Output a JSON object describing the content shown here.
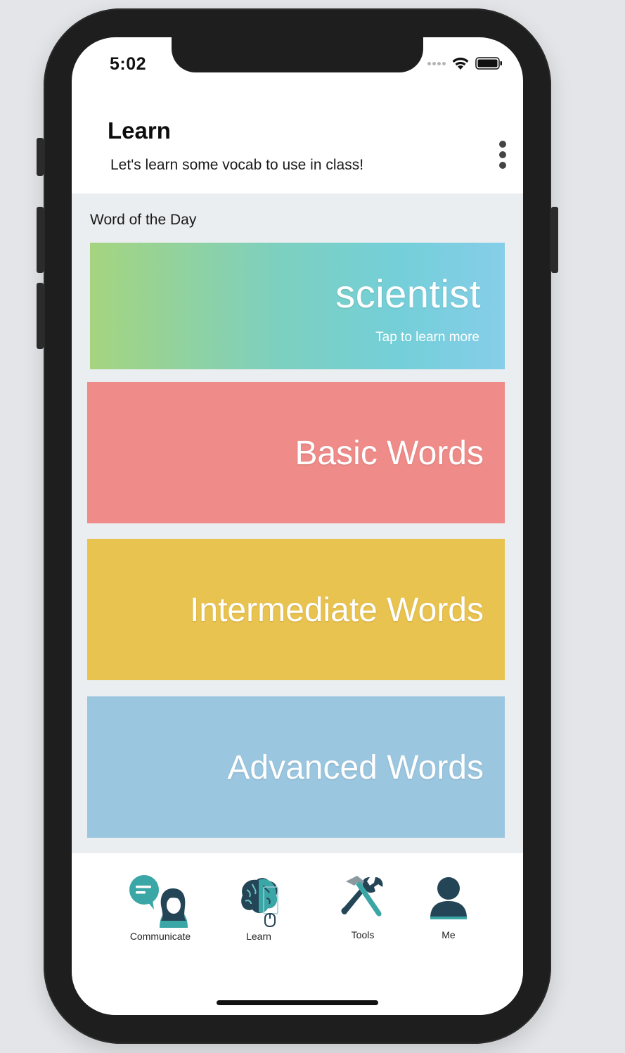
{
  "status_bar": {
    "time": "5:02"
  },
  "header": {
    "title": "Learn",
    "subtitle": "Let's learn some vocab to use in class!"
  },
  "word_of_the_day": {
    "section_label": "Word of the Day",
    "word": "scientist",
    "hint": "Tap to learn more"
  },
  "levels": [
    {
      "label": "Basic Words",
      "color": "#ef8b88"
    },
    {
      "label": "Intermediate Words",
      "color": "#e9c34f"
    },
    {
      "label": "Advanced Words",
      "color": "#9ac6e0"
    }
  ],
  "tabbar": {
    "tabs": [
      {
        "label": "Communicate",
        "icon": "communicate-icon"
      },
      {
        "label": "Learn",
        "icon": "brain-icon"
      },
      {
        "label": "Tools",
        "icon": "tools-icon"
      },
      {
        "label": "Me",
        "icon": "person-icon"
      }
    ]
  },
  "colors": {
    "accent_teal": "#3aa6a6",
    "dark_navy": "#244556"
  }
}
